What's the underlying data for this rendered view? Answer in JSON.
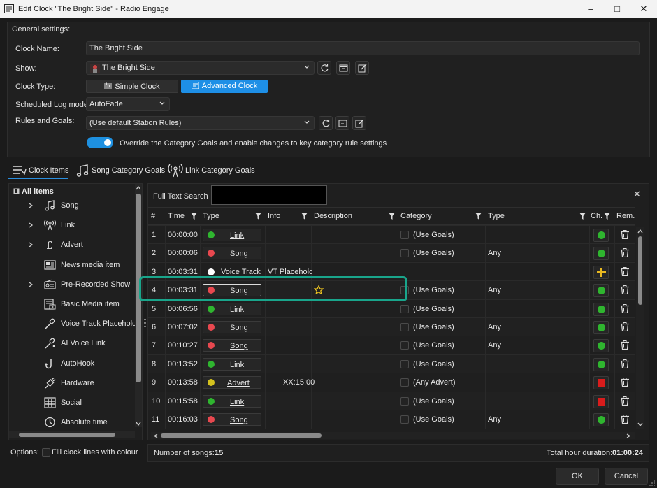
{
  "window": {
    "title": "Edit Clock \"The Bright Side\" - Radio Engage"
  },
  "general": {
    "heading": "General settings:",
    "clock_name_label": "Clock Name:",
    "clock_name_value": "The Bright Side",
    "show_label": "Show:",
    "show_value": "The Bright Side",
    "clock_type_label": "Clock Type:",
    "simple_clock": "Simple Clock",
    "advanced_clock": "Advanced Clock",
    "log_mode_label": "Scheduled Log mode:",
    "log_mode_value": "AutoFade",
    "rules_label": "Rules and Goals:",
    "rules_value": "(Use default Station Rules)",
    "override_text": "Override the Category Goals and enable changes to key category rule settings"
  },
  "tabs": [
    "Clock Items",
    "Song Category Goals",
    "Link Category Goals"
  ],
  "tree": {
    "root": "All items",
    "items": [
      {
        "label": "Song",
        "icon": "music-note-icon",
        "expandable": true
      },
      {
        "label": "Link",
        "icon": "broadcast-tower-icon",
        "expandable": true
      },
      {
        "label": "Advert",
        "icon": "pound-sign-icon",
        "expandable": true
      },
      {
        "label": "News media item",
        "icon": "newspaper-icon",
        "expandable": false
      },
      {
        "label": "Pre-Recorded Show",
        "icon": "radio-icon",
        "expandable": true
      },
      {
        "label": "Basic Media item",
        "icon": "media-file-icon",
        "expandable": false
      },
      {
        "label": "Voice Track Placeholde",
        "icon": "microphone-icon",
        "expandable": false
      },
      {
        "label": "AI Voice Link",
        "icon": "microphone-ai-icon",
        "expandable": false
      },
      {
        "label": "AutoHook",
        "icon": "hook-icon",
        "expandable": false
      },
      {
        "label": "Hardware",
        "icon": "plug-icon",
        "expandable": false
      },
      {
        "label": "Social",
        "icon": "hashtag-icon",
        "expandable": false
      },
      {
        "label": "Absolute time",
        "icon": "clock-icon",
        "expandable": false
      }
    ]
  },
  "search": {
    "label": "Full Text Search",
    "value": ""
  },
  "columns": {
    "num": "#",
    "time": "Time",
    "type": "Type",
    "info": "Info",
    "description": "Description",
    "category": "Category",
    "type2": "Type",
    "ch": "Ch.",
    "rem": "Rem."
  },
  "rows": [
    {
      "num": "1",
      "time": "00:00:00",
      "type": "Link",
      "type_color": "#2fb52f",
      "info": "",
      "desc_star": false,
      "category": "(Use Goals)",
      "type2": "",
      "ch": "green"
    },
    {
      "num": "2",
      "time": "00:00:06",
      "type": "Song",
      "type_color": "#e8484f",
      "info": "",
      "desc_star": false,
      "category": "(Use Goals)",
      "type2": "Any",
      "ch": "green"
    },
    {
      "num": "3",
      "time": "00:03:31",
      "type": "Voice Track",
      "type_color": "#ffffff",
      "info": "VT Placeholde",
      "desc_star": false,
      "category": "",
      "type2": "",
      "ch": "plus"
    },
    {
      "num": "4",
      "time": "00:03:31",
      "type": "Song",
      "type_color": "#e8484f",
      "info": "",
      "desc_star": true,
      "category": "(Use Goals)",
      "type2": "Any",
      "ch": "green"
    },
    {
      "num": "5",
      "time": "00:06:56",
      "type": "Link",
      "type_color": "#2fb52f",
      "info": "",
      "desc_star": false,
      "category": "(Use Goals)",
      "type2": "",
      "ch": "green"
    },
    {
      "num": "6",
      "time": "00:07:02",
      "type": "Song",
      "type_color": "#e8484f",
      "info": "",
      "desc_star": false,
      "category": "(Use Goals)",
      "type2": "Any",
      "ch": "green"
    },
    {
      "num": "7",
      "time": "00:10:27",
      "type": "Song",
      "type_color": "#e8484f",
      "info": "",
      "desc_star": false,
      "category": "(Use Goals)",
      "type2": "Any",
      "ch": "green"
    },
    {
      "num": "8",
      "time": "00:13:52",
      "type": "Link",
      "type_color": "#2fb52f",
      "info": "",
      "desc_star": false,
      "category": "(Use Goals)",
      "type2": "",
      "ch": "green"
    },
    {
      "num": "9",
      "time": "00:13:58",
      "type": "Advert",
      "type_color": "#d4c21e",
      "info": "XX:15:00",
      "desc_star": false,
      "category": "(Any Advert)",
      "type2": "",
      "ch": "red"
    },
    {
      "num": "10",
      "time": "00:15:58",
      "type": "Link",
      "type_color": "#2fb52f",
      "info": "",
      "desc_star": false,
      "category": "(Use Goals)",
      "type2": "",
      "ch": "red"
    },
    {
      "num": "11",
      "time": "00:16:03",
      "type": "Song",
      "type_color": "#e8484f",
      "info": "",
      "desc_star": false,
      "category": "(Use Goals)",
      "type2": "Any",
      "ch": "green"
    }
  ],
  "footer": {
    "options_label": "Options:",
    "fill_label": "Fill clock lines with colour",
    "num_songs_label": "Number of songs:",
    "num_songs": "15",
    "duration_label": "Total hour duration:",
    "duration": "01:00:24",
    "ok": "OK",
    "cancel": "Cancel"
  },
  "colors": {
    "accent": "#2a8fe0",
    "highlight": "#19a58b",
    "green": "#2fb52f",
    "red": "#d91c1c",
    "plus": "#e8b820"
  }
}
